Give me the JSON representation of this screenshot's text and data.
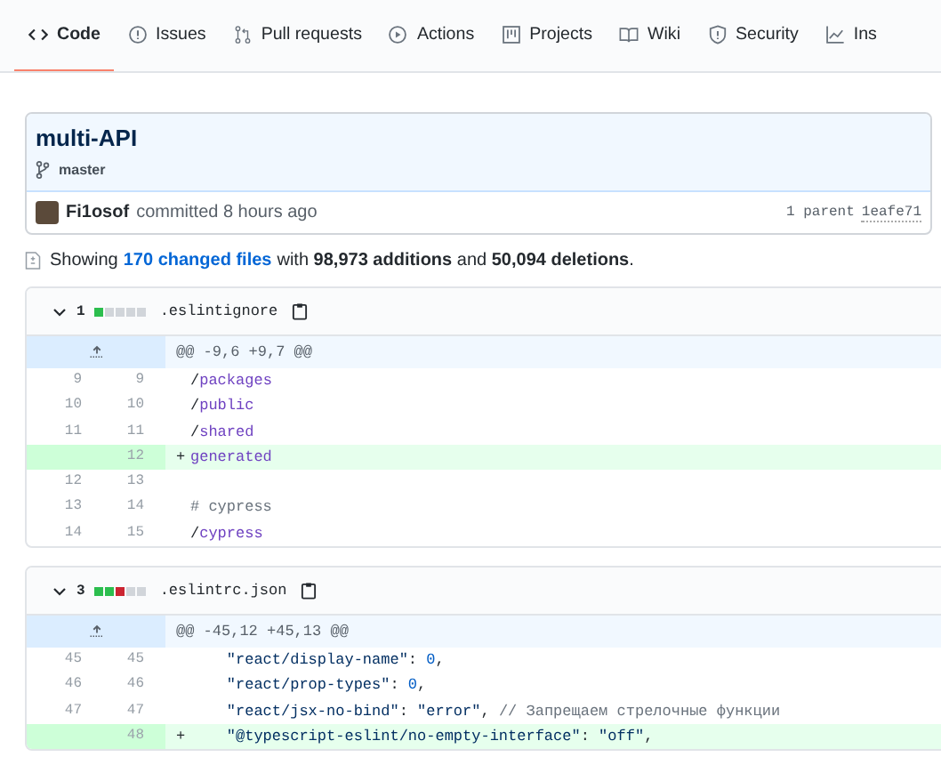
{
  "tabs": [
    {
      "label": "Code",
      "selected": true
    },
    {
      "label": "Issues",
      "selected": false
    },
    {
      "label": "Pull requests",
      "selected": false
    },
    {
      "label": "Actions",
      "selected": false
    },
    {
      "label": "Projects",
      "selected": false
    },
    {
      "label": "Wiki",
      "selected": false
    },
    {
      "label": "Security",
      "selected": false
    },
    {
      "label": "Ins",
      "selected": false
    }
  ],
  "commit": {
    "title": "multi-API",
    "branch": "master",
    "author": "Fi1osof",
    "action": "committed 8 hours ago",
    "parent_label": "1 parent",
    "parent_sha": "1eafe71"
  },
  "summary": {
    "text": "Showing",
    "link": "170 changed files",
    "rest": "with **98,973 additions** and **50,094 deletions**."
  },
  "files": [
    {
      "expanded": true,
      "count": "1",
      "stat": [
        {
          "kind": "added"
        },
        {
          "kind": "neutral"
        },
        {
          "kind": "neutral"
        },
        {
          "kind": "neutral"
        },
        {
          "kind": "neutral"
        }
      ],
      "name": ".eslintignore",
      "hunk": "@@ -9,6 +9,7 @@",
      "lines": [
        {
          "kind": "context",
          "old": "9",
          "new": "9",
          "tokens": [
            {
              "kind": "plain",
              "text": "/"
            },
            {
              "kind": "path",
              "text": "packages"
            }
          ]
        },
        {
          "kind": "context",
          "old": "10",
          "new": "10",
          "tokens": [
            {
              "kind": "plain",
              "text": "/"
            },
            {
              "kind": "path",
              "text": "public"
            }
          ]
        },
        {
          "kind": "context",
          "old": "11",
          "new": "11",
          "tokens": [
            {
              "kind": "plain",
              "text": "/"
            },
            {
              "kind": "path",
              "text": "shared"
            }
          ]
        },
        {
          "kind": "added",
          "marker": "+",
          "new": "12",
          "tokens": [
            {
              "kind": "path",
              "text": "generated"
            }
          ]
        },
        {
          "kind": "context",
          "old": "12",
          "new": "13"
        },
        {
          "kind": "context",
          "old": "13",
          "new": "14",
          "tokens": [
            {
              "kind": "comment",
              "text": "# cypress"
            }
          ]
        },
        {
          "kind": "context",
          "old": "14",
          "new": "15",
          "tokens": [
            {
              "kind": "plain",
              "text": "/"
            },
            {
              "kind": "path",
              "text": "cypress"
            }
          ]
        }
      ]
    },
    {
      "expanded": true,
      "count": "3",
      "stat": [
        {
          "kind": "added"
        },
        {
          "kind": "added"
        },
        {
          "kind": "deleted"
        },
        {
          "kind": "neutral"
        },
        {
          "kind": "neutral"
        }
      ],
      "name": ".eslintrc.json",
      "hunk": "@@ -45,12 +45,13 @@",
      "lines": [
        {
          "kind": "context",
          "old": "45",
          "new": "45",
          "tokens": [
            {
              "kind": "string",
              "text": "    \"react/display-name\""
            },
            {
              "kind": "plain",
              "text": ": "
            },
            {
              "kind": "number",
              "text": "0"
            },
            {
              "kind": "plain",
              "text": ","
            }
          ]
        },
        {
          "kind": "context",
          "old": "46",
          "new": "46",
          "tokens": [
            {
              "kind": "string",
              "text": "    \"react/prop-types\""
            },
            {
              "kind": "plain",
              "text": ": "
            },
            {
              "kind": "number",
              "text": "0"
            },
            {
              "kind": "plain",
              "text": ","
            }
          ]
        },
        {
          "kind": "context",
          "old": "47",
          "new": "47",
          "tokens": [
            {
              "kind": "string",
              "text": "    \"react/jsx-no-bind\""
            },
            {
              "kind": "plain",
              "text": ": "
            },
            {
              "kind": "string",
              "text": "\"error\""
            },
            {
              "kind": "plain",
              "text": ", "
            },
            {
              "kind": "comment",
              "text": "// Запрещаем стрелочные функции"
            }
          ]
        },
        {
          "kind": "added",
          "marker": "+",
          "new": "48",
          "tokens": [
            {
              "kind": "string",
              "text": "    \"@typescript-eslint/no-empty-interface\""
            },
            {
              "kind": "plain",
              "text": ": "
            },
            {
              "kind": "string",
              "text": "\"off\""
            },
            {
              "kind": "plain",
              "text": ","
            }
          ]
        }
      ]
    }
  ]
}
